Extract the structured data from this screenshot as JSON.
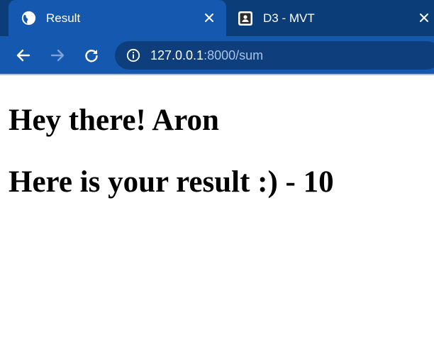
{
  "tabs": [
    {
      "title": "Result",
      "icon": "globe-icon",
      "active": true
    },
    {
      "title": "D3 - MVT",
      "icon": "contact-icon",
      "active": false
    }
  ],
  "address_bar": {
    "host": "127.0.0.1",
    "rest": ":8000/sum"
  },
  "page": {
    "greeting": "Hey there! Aron",
    "result": "Here is your result :) - 10"
  },
  "colors": {
    "tabstrip": "#0b3d78",
    "toolbar": "#1558b0",
    "omnibox": "#0e3e7c"
  }
}
